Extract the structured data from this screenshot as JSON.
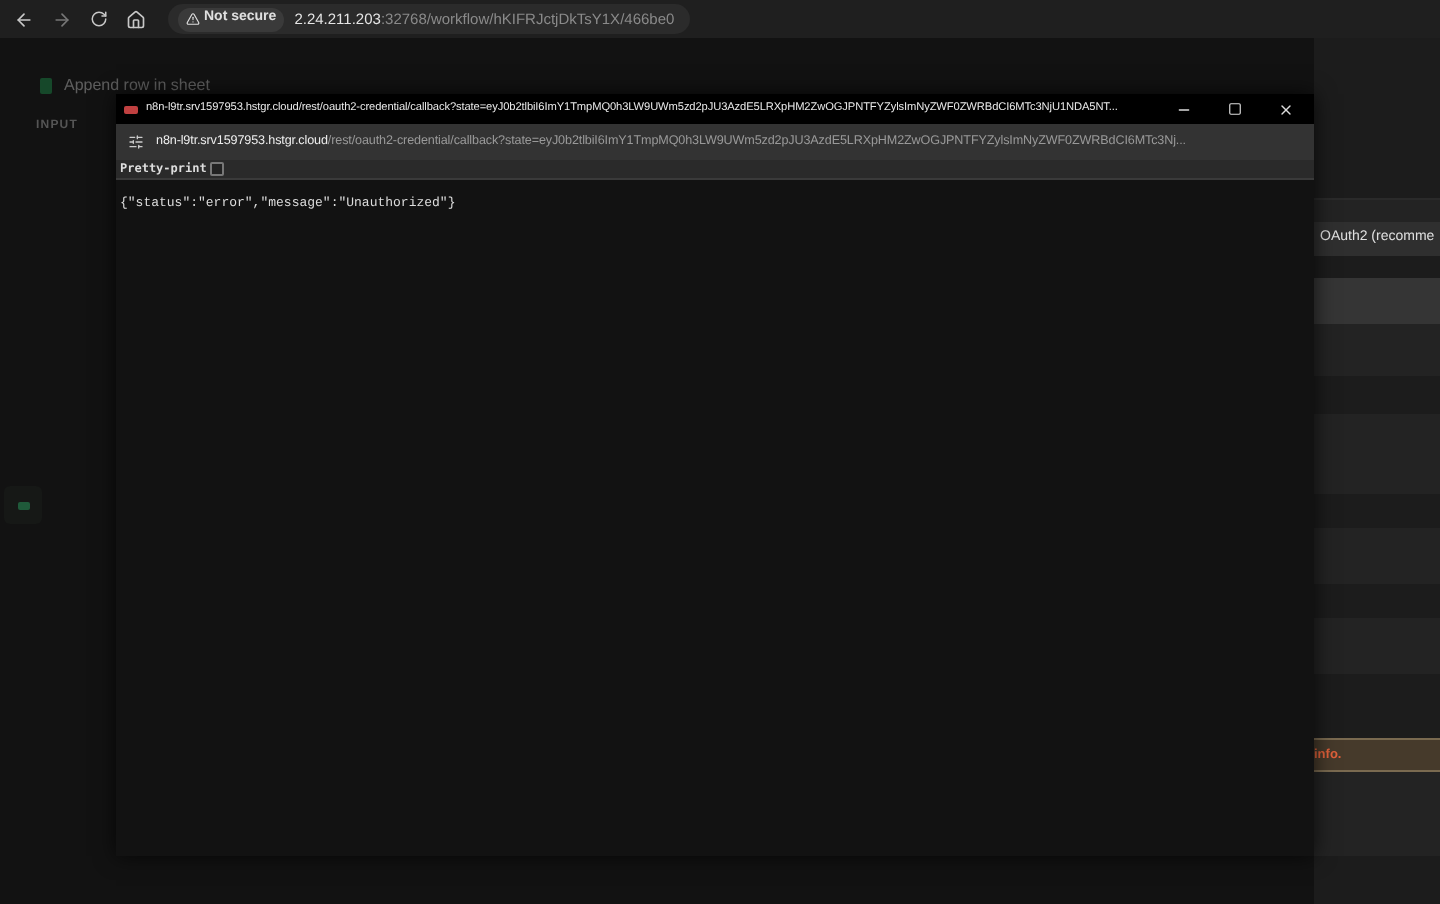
{
  "browser": {
    "security": "Not secure",
    "url_host": "2.24.211.203",
    "url_rest": ":32768/workflow/hKIFRJctjDkTsY1X/466be0"
  },
  "background": {
    "node_title": "Append row in sheet",
    "input_label": "INPUT",
    "auth_select": "OAuth2 (recomme",
    "warning": "info."
  },
  "popup": {
    "title": "n8n-l9tr.srv1597953.hstgr.cloud/rest/oauth2-credential/callback?state=eyJ0b2tlbiI6ImY1TmpMQ0h3LW9UWm5zd2pJU3AzdE5LRXpHM2ZwOGJPNTFYZylsImNyZWF0ZWRBdCI6MTc3NjU1NDA5NT...",
    "address_host": "n8n-l9tr.srv1597953.hstgr.cloud",
    "address_path": "/rest/oauth2-credential/callback?state=eyJ0b2tlbiI6ImY1TmpMQ0h3LW9UWm5zd2pJU3AzdE5LRXpHM2ZwOGJPNTFYZylsImNyZWF0ZWRBdCI6MTc3Nj...",
    "pretty_print": {
      "label": "Pretty-print",
      "checked": false
    },
    "body": "{\"status\":\"error\",\"message\":\"Unauthorized\"}"
  }
}
